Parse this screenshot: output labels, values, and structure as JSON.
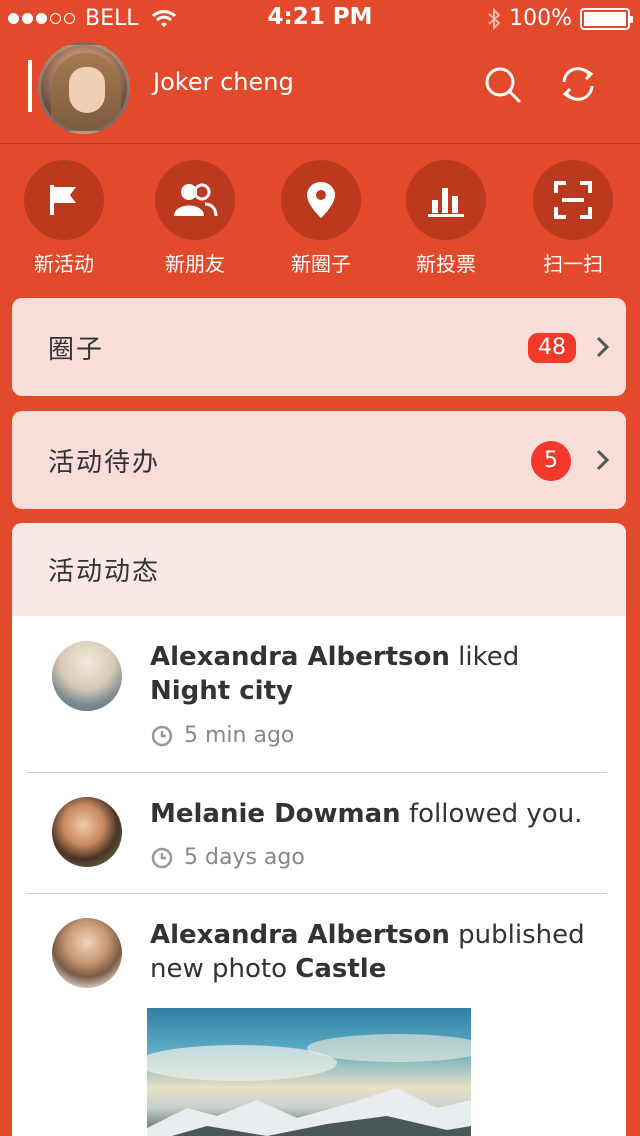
{
  "status_bar": {
    "carrier": "BELL",
    "time": "4:21 PM",
    "battery": "100%",
    "signal_dots_filled": 3,
    "signal_dots_total": 5
  },
  "header": {
    "username": "Joker cheng",
    "icons": [
      "menu-icon",
      "search-icon",
      "refresh-icon"
    ]
  },
  "actions": [
    {
      "label": "新活动",
      "icon": "flag-icon"
    },
    {
      "label": "新朋友",
      "icon": "friends-icon"
    },
    {
      "label": "新圈子",
      "icon": "location-pin-icon"
    },
    {
      "label": "新投票",
      "icon": "bar-chart-icon"
    },
    {
      "label": "扫一扫",
      "icon": "scan-icon"
    }
  ],
  "rows": {
    "circles": {
      "title": "圈子",
      "badge": "48"
    },
    "todo": {
      "title": "活动待办",
      "badge": "5"
    }
  },
  "feed": {
    "title": "活动动态",
    "items": [
      {
        "name": "Alexandra Albertson",
        "action": " liked ",
        "object": "Night city",
        "time": "5 min ago"
      },
      {
        "name": "Melanie Dowman",
        "action": " followed you.",
        "object": "",
        "time": "5 days ago"
      },
      {
        "name": "Alexandra Albertson",
        "action": " published new photo ",
        "object": "Castle",
        "time": ""
      }
    ]
  },
  "colors": {
    "primary": "#e24a2b",
    "action_circle": "#bb3a1f",
    "card": "#f9ddd8",
    "badge": "#f4392a"
  }
}
